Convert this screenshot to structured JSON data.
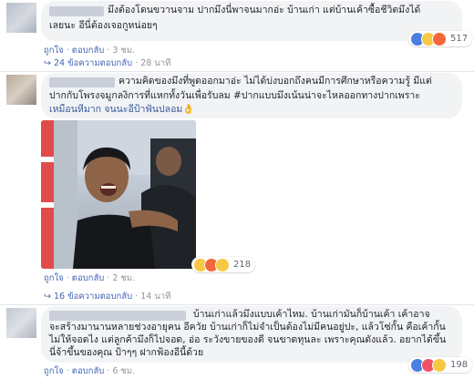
{
  "comments": [
    {
      "lines": [
        "มึงต้องโดนขวานจาม   ปากมึงนี่พาจนมากอ่ะ บ้านเก่า แต่บ้านเค้าซื้อชีวิตมึงได้",
        "เลยนะ อีนี่ต้องเจอกูหน่อยๆ"
      ],
      "actions": {
        "like": "ถูกใจ",
        "reply": "ตอบกลับ",
        "time": "3 ชม."
      },
      "reactions": {
        "count": "517",
        "icons": [
          "like-icon",
          "haha-icon",
          "angry-icon"
        ]
      },
      "replies": {
        "text": "24 ข้อความตอบกลับ",
        "time": "28 นาที"
      }
    },
    {
      "lines": [
        "ความคิดของมึงที่พูดออกมาอ่ะ ไม่ได้บ่งบอกถึงคนมีการศึกษาหรือความรู้ มีแต่",
        "ปากกับโพรงจมูกลงิการที่แหกทั้งวันเพื่อรับลม #ปากแบบมึงเน้นน่าจะไหลออกทางปากเพราะ",
        "เหมือนหีมาก จนนะอีป้าฟันปลอม👌"
      ],
      "actions": {
        "like": "ถูกใจ",
        "reply": "ตอบกลับ",
        "time": "2 ชม."
      },
      "reactions": {
        "count": "218",
        "icons": [
          "haha-icon",
          "angry-icon",
          "wow-icon"
        ]
      },
      "replies": {
        "text": "16 ข้อความตอบกลับ",
        "time": "14 นาที"
      }
    },
    {
      "lines": [
        "บ้านเก่าแล้วมึงแบบเค้าไหม. บ้านเก่ามันก็บ้านเค้า เค้าอาจ",
        "จะสร้างมานานหลายช่วงอายุคน อีควัย บ้านเก่าก็ไม่จำเป็นต้องไม่มีคนอยู่ปะ, แล้วโซ่กั้น คือเค้ากั้น",
        "ไม่ให้จอดไง แต่ลูกค้ามึงก็ไปจอด, อ่อ ระวังขายของดี จนขาดทุนละ เพราะคุณดังแล้ว. อยากได้ขึ้น",
        "นี่จ้าขึ้นของคุณ ป้าๆๆ ฝากฟ้องอีนี้ด้วย"
      ],
      "actions": {
        "like": "ถูกใจ",
        "reply": "ตอบกลับ",
        "time": "6 ชม."
      },
      "reactions": {
        "count": "198",
        "icons": [
          "like-icon",
          "love-icon",
          "haha-icon"
        ]
      }
    }
  ],
  "colors": {
    "link": "#4267b2",
    "bubble": "#f2f3f5",
    "meta": "#90949c"
  }
}
